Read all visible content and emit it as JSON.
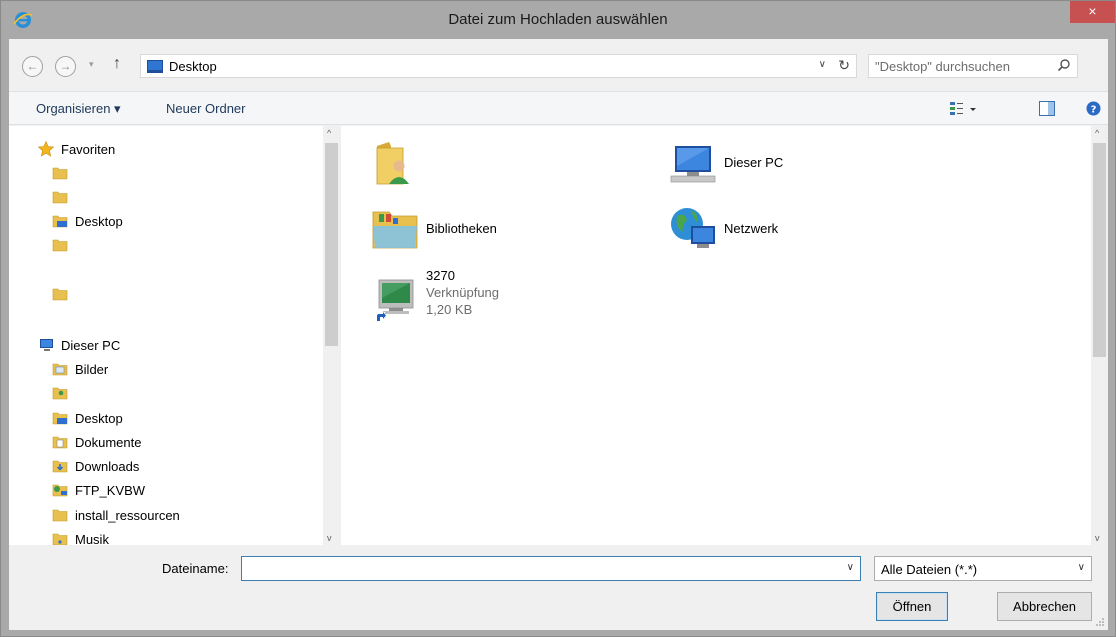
{
  "window": {
    "title": "Datei zum Hochladen auswählen",
    "close_glyph": "×"
  },
  "address_bar": {
    "back_glyph": "←",
    "forward_glyph": "→",
    "recent_glyph": "▾",
    "up_glyph": "↑",
    "location": "Desktop",
    "dropdown_glyph": "∨",
    "refresh_glyph": "↻"
  },
  "search": {
    "placeholder": "\"Desktop\" durchsuchen"
  },
  "toolbar": {
    "organize_label": "Organisieren ▾",
    "new_folder_label": "Neuer Ordner"
  },
  "nav_pane": {
    "favorites_header": "Favoriten",
    "favorites": [
      "",
      "",
      "Desktop",
      "",
      ""
    ],
    "this_pc_header": "Dieser PC",
    "this_pc_items": [
      "Bilder",
      "",
      "Desktop",
      "Dokumente",
      "Downloads",
      "FTP_KVBW",
      "install_ressourcen",
      "Musik"
    ],
    "scroll_up": "^",
    "scroll_down": "v"
  },
  "main_pane": {
    "items": [
      {
        "name": "",
        "icon": "user-folder-icon"
      },
      {
        "name": "Dieser PC",
        "icon": "computer-icon"
      },
      {
        "name": "Bibliotheken",
        "icon": "libraries-icon"
      },
      {
        "name": "Netzwerk",
        "icon": "network-icon"
      },
      {
        "name": "3270",
        "type": "Verknüpfung",
        "size": "1,20 KB",
        "icon": "shortcut-monitor-icon"
      }
    ],
    "scroll_up": "^",
    "scroll_down": "v"
  },
  "bottom": {
    "filename_label": "Dateiname:",
    "filename_value": "",
    "filetype_selected": "Alle Dateien (*.*)",
    "open_button": "Öffnen",
    "cancel_button": "Abbrechen",
    "dropdown_glyph": "∨"
  },
  "colors": {
    "accent": "#3c7fb1",
    "close": "#c75050",
    "folder": "#e8c04f"
  }
}
